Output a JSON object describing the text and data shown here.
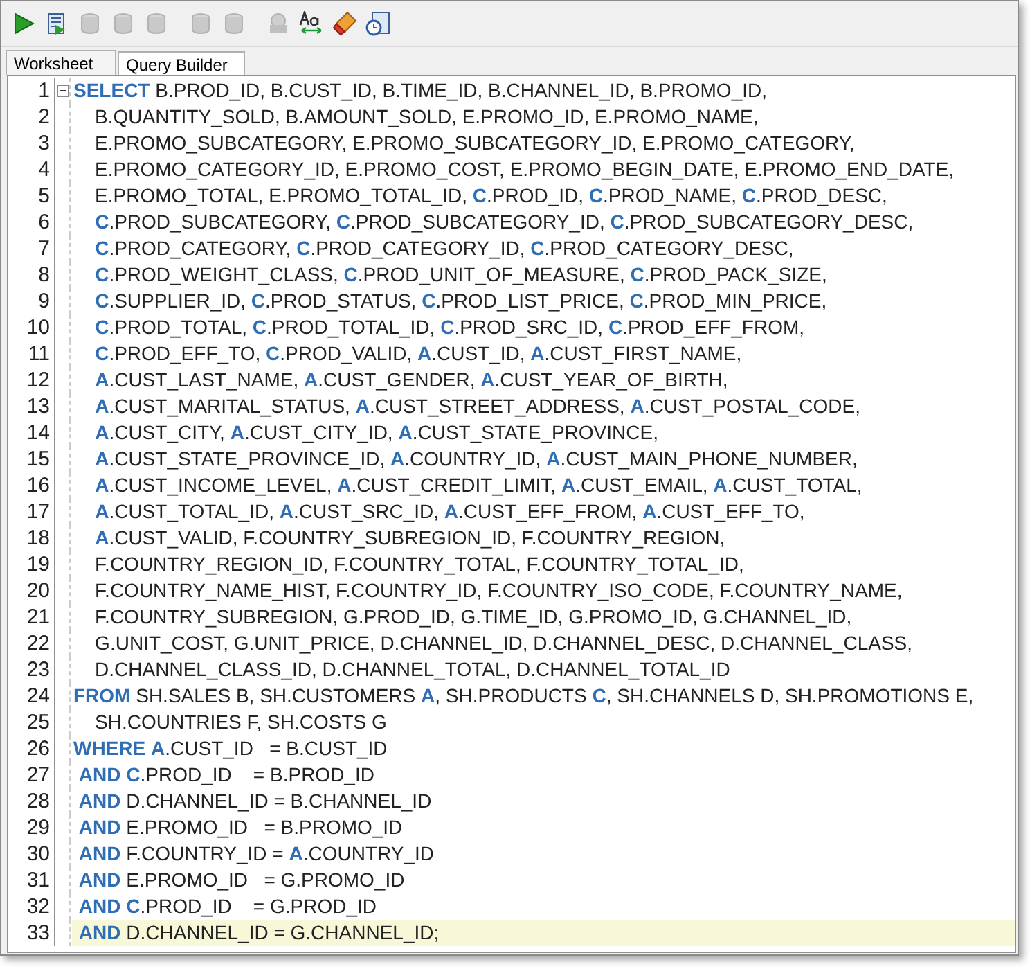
{
  "toolbar": [
    [
      {
        "kind": "run",
        "disabled": false
      },
      {
        "kind": "script",
        "disabled": false
      },
      {
        "kind": "commit",
        "disabled": true
      },
      {
        "kind": "rollback",
        "disabled": true
      },
      {
        "kind": "explain",
        "disabled": true
      }
    ],
    [
      {
        "kind": "autotrace",
        "disabled": true
      },
      {
        "kind": "tuning",
        "disabled": true
      }
    ],
    [
      {
        "kind": "sql",
        "disabled": true
      },
      {
        "kind": "format",
        "disabled": false
      },
      {
        "kind": "clear",
        "disabled": false
      },
      {
        "kind": "history",
        "disabled": false
      }
    ]
  ],
  "tabs": [
    {
      "label": "Worksheet",
      "selected": true
    },
    {
      "label": "Query Builder",
      "selected": false
    }
  ],
  "editor": {
    "lines": [
      {
        "number": "1",
        "fold_marker": true,
        "current": false,
        "code": "**SELECT** B.PROD_ID, B.CUST_ID, B.TIME_ID, B.CHANNEL_ID, B.PROMO_ID,"
      },
      {
        "number": "2",
        "fold_marker": false,
        "current": false,
        "code": "    B.QUANTITY_SOLD, B.AMOUNT_SOLD, E.PROMO_ID, E.PROMO_NAME,"
      },
      {
        "number": "3",
        "fold_marker": false,
        "current": false,
        "code": "    E.PROMO_SUBCATEGORY, E.PROMO_SUBCATEGORY_ID, E.PROMO_CATEGORY,"
      },
      {
        "number": "4",
        "fold_marker": false,
        "current": false,
        "code": "    E.PROMO_CATEGORY_ID, E.PROMO_COST, E.PROMO_BEGIN_DATE, E.PROMO_END_DATE,"
      },
      {
        "number": "5",
        "fold_marker": false,
        "current": false,
        "code": "    E.PROMO_TOTAL, E.PROMO_TOTAL_ID, **C**.PROD_ID, **C**.PROD_NAME, **C**.PROD_DESC,"
      },
      {
        "number": "6",
        "fold_marker": false,
        "current": false,
        "code": "    **C**.PROD_SUBCATEGORY, **C**.PROD_SUBCATEGORY_ID, **C**.PROD_SUBCATEGORY_DESC,"
      },
      {
        "number": "7",
        "fold_marker": false,
        "current": false,
        "code": "    **C**.PROD_CATEGORY, **C**.PROD_CATEGORY_ID, **C**.PROD_CATEGORY_DESC,"
      },
      {
        "number": "8",
        "fold_marker": false,
        "current": false,
        "code": "    **C**.PROD_WEIGHT_CLASS, **C**.PROD_UNIT_OF_MEASURE, **C**.PROD_PACK_SIZE,"
      },
      {
        "number": "9",
        "fold_marker": false,
        "current": false,
        "code": "    **C**.SUPPLIER_ID, **C**.PROD_STATUS, **C**.PROD_LIST_PRICE, **C**.PROD_MIN_PRICE,"
      },
      {
        "number": "10",
        "fold_marker": false,
        "current": false,
        "code": "    **C**.PROD_TOTAL, **C**.PROD_TOTAL_ID, **C**.PROD_SRC_ID, **C**.PROD_EFF_FROM,"
      },
      {
        "number": "11",
        "fold_marker": false,
        "current": false,
        "code": "    **C**.PROD_EFF_TO, **C**.PROD_VALID, **A**.CUST_ID, **A**.CUST_FIRST_NAME,"
      },
      {
        "number": "12",
        "fold_marker": false,
        "current": false,
        "code": "    **A**.CUST_LAST_NAME, **A**.CUST_GENDER, **A**.CUST_YEAR_OF_BIRTH,"
      },
      {
        "number": "13",
        "fold_marker": false,
        "current": false,
        "code": "    **A**.CUST_MARITAL_STATUS, **A**.CUST_STREET_ADDRESS, **A**.CUST_POSTAL_CODE,"
      },
      {
        "number": "14",
        "fold_marker": false,
        "current": false,
        "code": "    **A**.CUST_CITY, **A**.CUST_CITY_ID, **A**.CUST_STATE_PROVINCE,"
      },
      {
        "number": "15",
        "fold_marker": false,
        "current": false,
        "code": "    **A**.CUST_STATE_PROVINCE_ID, **A**.COUNTRY_ID, **A**.CUST_MAIN_PHONE_NUMBER,"
      },
      {
        "number": "16",
        "fold_marker": false,
        "current": false,
        "code": "    **A**.CUST_INCOME_LEVEL, **A**.CUST_CREDIT_LIMIT, **A**.CUST_EMAIL, **A**.CUST_TOTAL,"
      },
      {
        "number": "17",
        "fold_marker": false,
        "current": false,
        "code": "    **A**.CUST_TOTAL_ID, **A**.CUST_SRC_ID, **A**.CUST_EFF_FROM, **A**.CUST_EFF_TO,"
      },
      {
        "number": "18",
        "fold_marker": false,
        "current": false,
        "code": "    **A**.CUST_VALID, F.COUNTRY_SUBREGION_ID, F.COUNTRY_REGION,"
      },
      {
        "number": "19",
        "fold_marker": false,
        "current": false,
        "code": "    F.COUNTRY_REGION_ID, F.COUNTRY_TOTAL, F.COUNTRY_TOTAL_ID,"
      },
      {
        "number": "20",
        "fold_marker": false,
        "current": false,
        "code": "    F.COUNTRY_NAME_HIST, F.COUNTRY_ID, F.COUNTRY_ISO_CODE, F.COUNTRY_NAME,"
      },
      {
        "number": "21",
        "fold_marker": false,
        "current": false,
        "code": "    F.COUNTRY_SUBREGION, G.PROD_ID, G.TIME_ID, G.PROMO_ID, G.CHANNEL_ID,"
      },
      {
        "number": "22",
        "fold_marker": false,
        "current": false,
        "code": "    G.UNIT_COST, G.UNIT_PRICE, D.CHANNEL_ID, D.CHANNEL_DESC, D.CHANNEL_CLASS,"
      },
      {
        "number": "23",
        "fold_marker": false,
        "current": false,
        "code": "    D.CHANNEL_CLASS_ID, D.CHANNEL_TOTAL, D.CHANNEL_TOTAL_ID"
      },
      {
        "number": "24",
        "fold_marker": false,
        "current": false,
        "code": "**FROM** SH.SALES B, SH.CUSTOMERS **A**, SH.PRODUCTS **C**, SH.CHANNELS D, SH.PROMOTIONS E,"
      },
      {
        "number": "25",
        "fold_marker": false,
        "current": false,
        "code": "    SH.COUNTRIES F, SH.COSTS G"
      },
      {
        "number": "26",
        "fold_marker": false,
        "current": false,
        "code": "**WHERE** **A**.CUST_ID   = B.CUST_ID"
      },
      {
        "number": "27",
        "fold_marker": false,
        "current": false,
        "code": " **AND** **C**.PROD_ID    = B.PROD_ID"
      },
      {
        "number": "28",
        "fold_marker": false,
        "current": false,
        "code": " **AND** D.CHANNEL_ID = B.CHANNEL_ID"
      },
      {
        "number": "29",
        "fold_marker": false,
        "current": false,
        "code": " **AND** E.PROMO_ID   = B.PROMO_ID"
      },
      {
        "number": "30",
        "fold_marker": false,
        "current": false,
        "code": " **AND** F.COUNTRY_ID = **A**.COUNTRY_ID"
      },
      {
        "number": "31",
        "fold_marker": false,
        "current": false,
        "code": " **AND** E.PROMO_ID   = G.PROMO_ID"
      },
      {
        "number": "32",
        "fold_marker": false,
        "current": false,
        "code": " **AND** **C**.PROD_ID    = G.PROD_ID"
      },
      {
        "number": "33",
        "fold_marker": false,
        "current": true,
        "code": " **AND** D.CHANNEL_ID = G.CHANNEL_ID;"
      }
    ]
  }
}
